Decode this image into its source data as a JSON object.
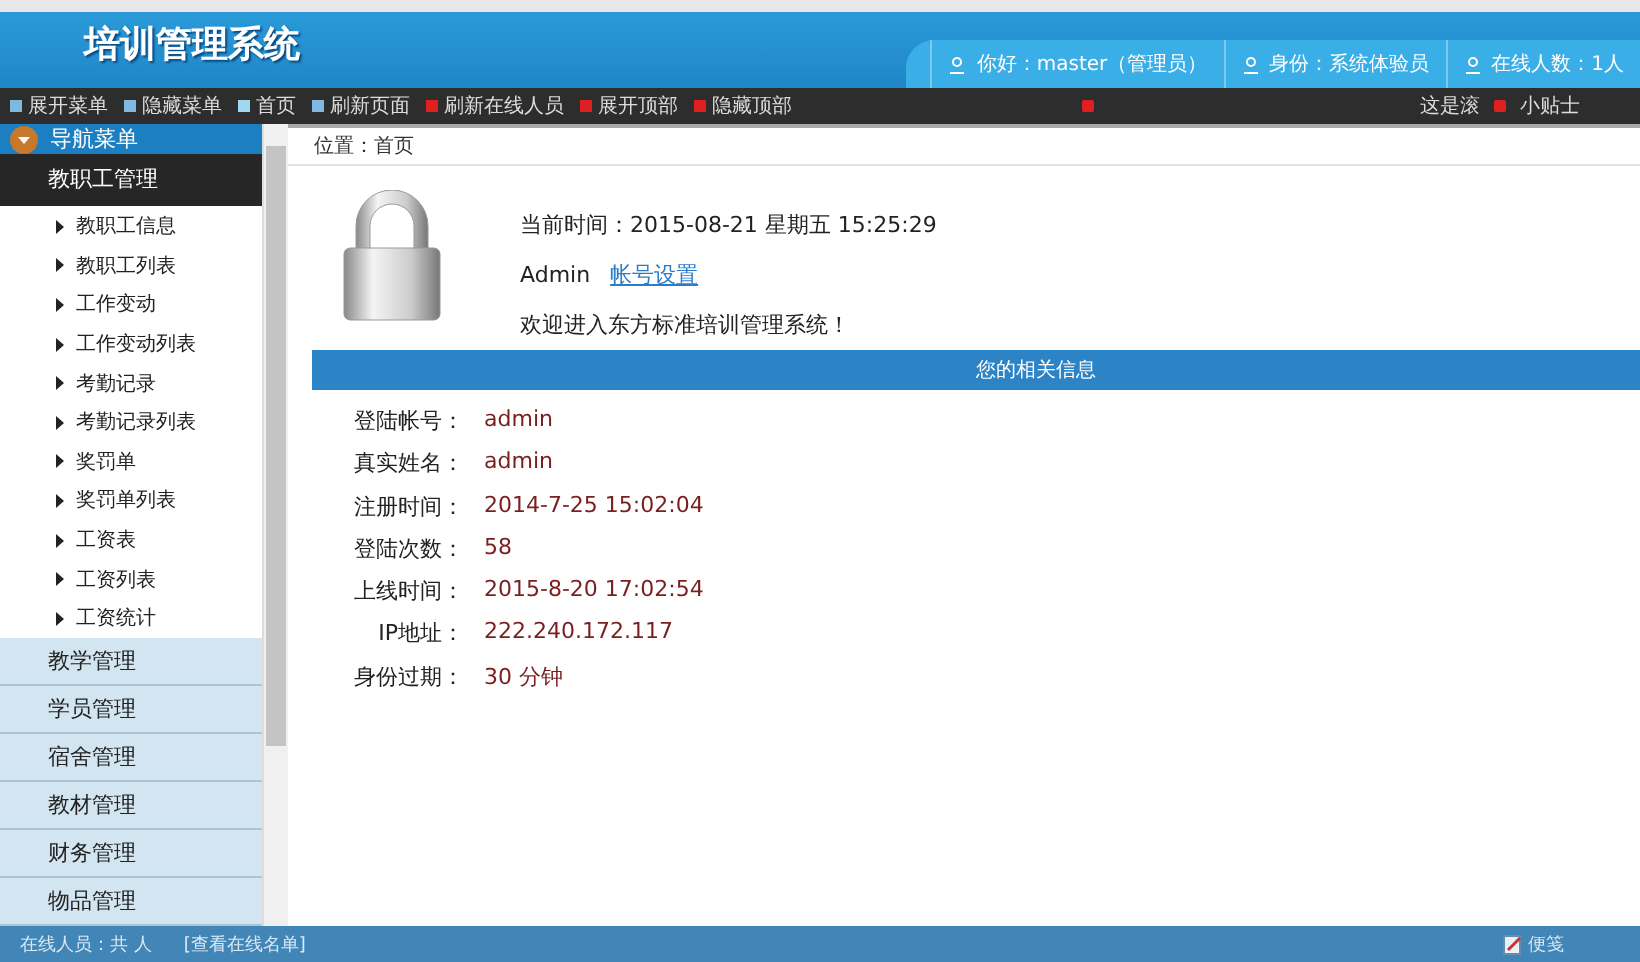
{
  "header": {
    "title": "培训管理系统",
    "tabs": [
      {
        "label": "你好：master（管理员）"
      },
      {
        "label": "身份：系统体验员"
      },
      {
        "label": "在线人数：1人"
      }
    ]
  },
  "toolbar": {
    "items": [
      {
        "label": "展开菜单",
        "color": "#7fb8e0"
      },
      {
        "label": "隐藏菜单",
        "color": "#7fb8e0"
      },
      {
        "label": "首页",
        "color": "#9fd8f0"
      },
      {
        "label": "刷新页面",
        "color": "#7fb8e0"
      },
      {
        "label": "刷新在线人员",
        "color": "#e02020"
      },
      {
        "label": "展开顶部",
        "color": "#e02020"
      },
      {
        "label": "隐藏顶部",
        "color": "#e02020"
      }
    ],
    "ticker": "这是滚",
    "tips": "小贴士"
  },
  "sidebar": {
    "title": "导航菜单",
    "groups": [
      {
        "label": "教职工管理",
        "expanded": true,
        "children": [
          {
            "label": "教职工信息"
          },
          {
            "label": "教职工列表"
          },
          {
            "label": "工作变动"
          },
          {
            "label": "工作变动列表"
          },
          {
            "label": "考勤记录"
          },
          {
            "label": "考勤记录列表"
          },
          {
            "label": "奖罚单"
          },
          {
            "label": "奖罚单列表"
          },
          {
            "label": "工资表"
          },
          {
            "label": "工资列表"
          },
          {
            "label": "工资统计"
          }
        ]
      },
      {
        "label": "教学管理",
        "expanded": false
      },
      {
        "label": "学员管理",
        "expanded": false
      },
      {
        "label": "宿舍管理",
        "expanded": false
      },
      {
        "label": "教材管理",
        "expanded": false
      },
      {
        "label": "财务管理",
        "expanded": false
      },
      {
        "label": "物品管理",
        "expanded": false
      }
    ]
  },
  "breadcrumb": "位置：首页",
  "welcome": {
    "time": "当前时间：2015-08-21 星期五 15:25:29",
    "user": "Admin",
    "account_link": "帐号设置",
    "message": "欢迎进入东方标准培训管理系统！"
  },
  "info": {
    "title": "您的相关信息",
    "rows": [
      {
        "label": "登陆帐号：",
        "value": "admin"
      },
      {
        "label": "真实姓名：",
        "value": "admin"
      },
      {
        "label": "注册时间：",
        "value": "2014-7-25 15:02:04"
      },
      {
        "label": "登陆次数：",
        "value": "58"
      },
      {
        "label": "上线时间：",
        "value": "2015-8-20 17:02:54"
      },
      {
        "label": "IP地址：",
        "value": "222.240.172.117"
      },
      {
        "label": "身份过期：",
        "value": "30 分钟"
      }
    ]
  },
  "status_bar": {
    "online": "在线人员：共 人",
    "view_link": "[查看在线名单]",
    "notes": "便笺"
  }
}
